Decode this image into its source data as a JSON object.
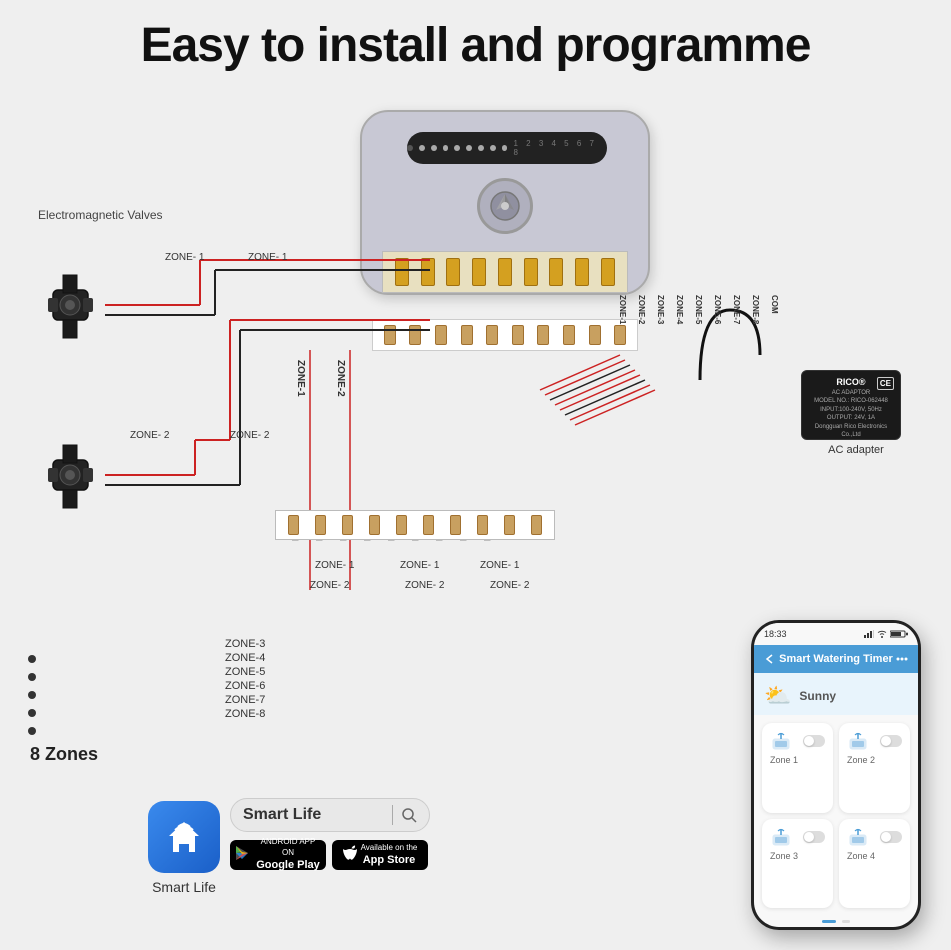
{
  "page": {
    "title": "Easy to install and  programme",
    "background_color": "#efefef"
  },
  "labels": {
    "electromagnetic_valves": "Electromagnetic Valves",
    "zone1_label_top": "ZONE-1",
    "zone2_label_top": "ZONE-1",
    "zone1_label_left": "ZONE-1",
    "zone2_label_left": "ZONE-2",
    "zone1_bottom": "ZONE-1",
    "zone2_bottom": "ZONE-2",
    "zone1_valve2": "ZONE-2",
    "zone_list": [
      "ZONE-3",
      "ZONE-4",
      "ZONE-5",
      "ZONE-6",
      "ZONE-7",
      "ZONE-8"
    ],
    "eight_zones": "8 Zones",
    "ac_adapter": "AC adapter",
    "smart_life_app": "Smart Life",
    "app_store": "App Store",
    "google_play_title": "Google Play",
    "app_store_title": "App Store",
    "google_play_subtitle": "ANDROID APP ON",
    "app_store_subtitle": "Available on the",
    "search_text": "Smart Life",
    "phone_app_title": "Smart Watering Timer",
    "phone_weather": "Sunny",
    "phone_time": "18:33",
    "zones": [
      {
        "name": "Zone 1"
      },
      {
        "name": "Zone 2"
      },
      {
        "name": "Zone 3"
      },
      {
        "name": "Zone 4"
      }
    ]
  },
  "colors": {
    "accent": "#4a9cd6",
    "wire_red": "#cc2222",
    "wire_black": "#222222",
    "controller_bg": "#c8c8d4",
    "terminal_gold": "#d4a020",
    "title": "#111111"
  }
}
